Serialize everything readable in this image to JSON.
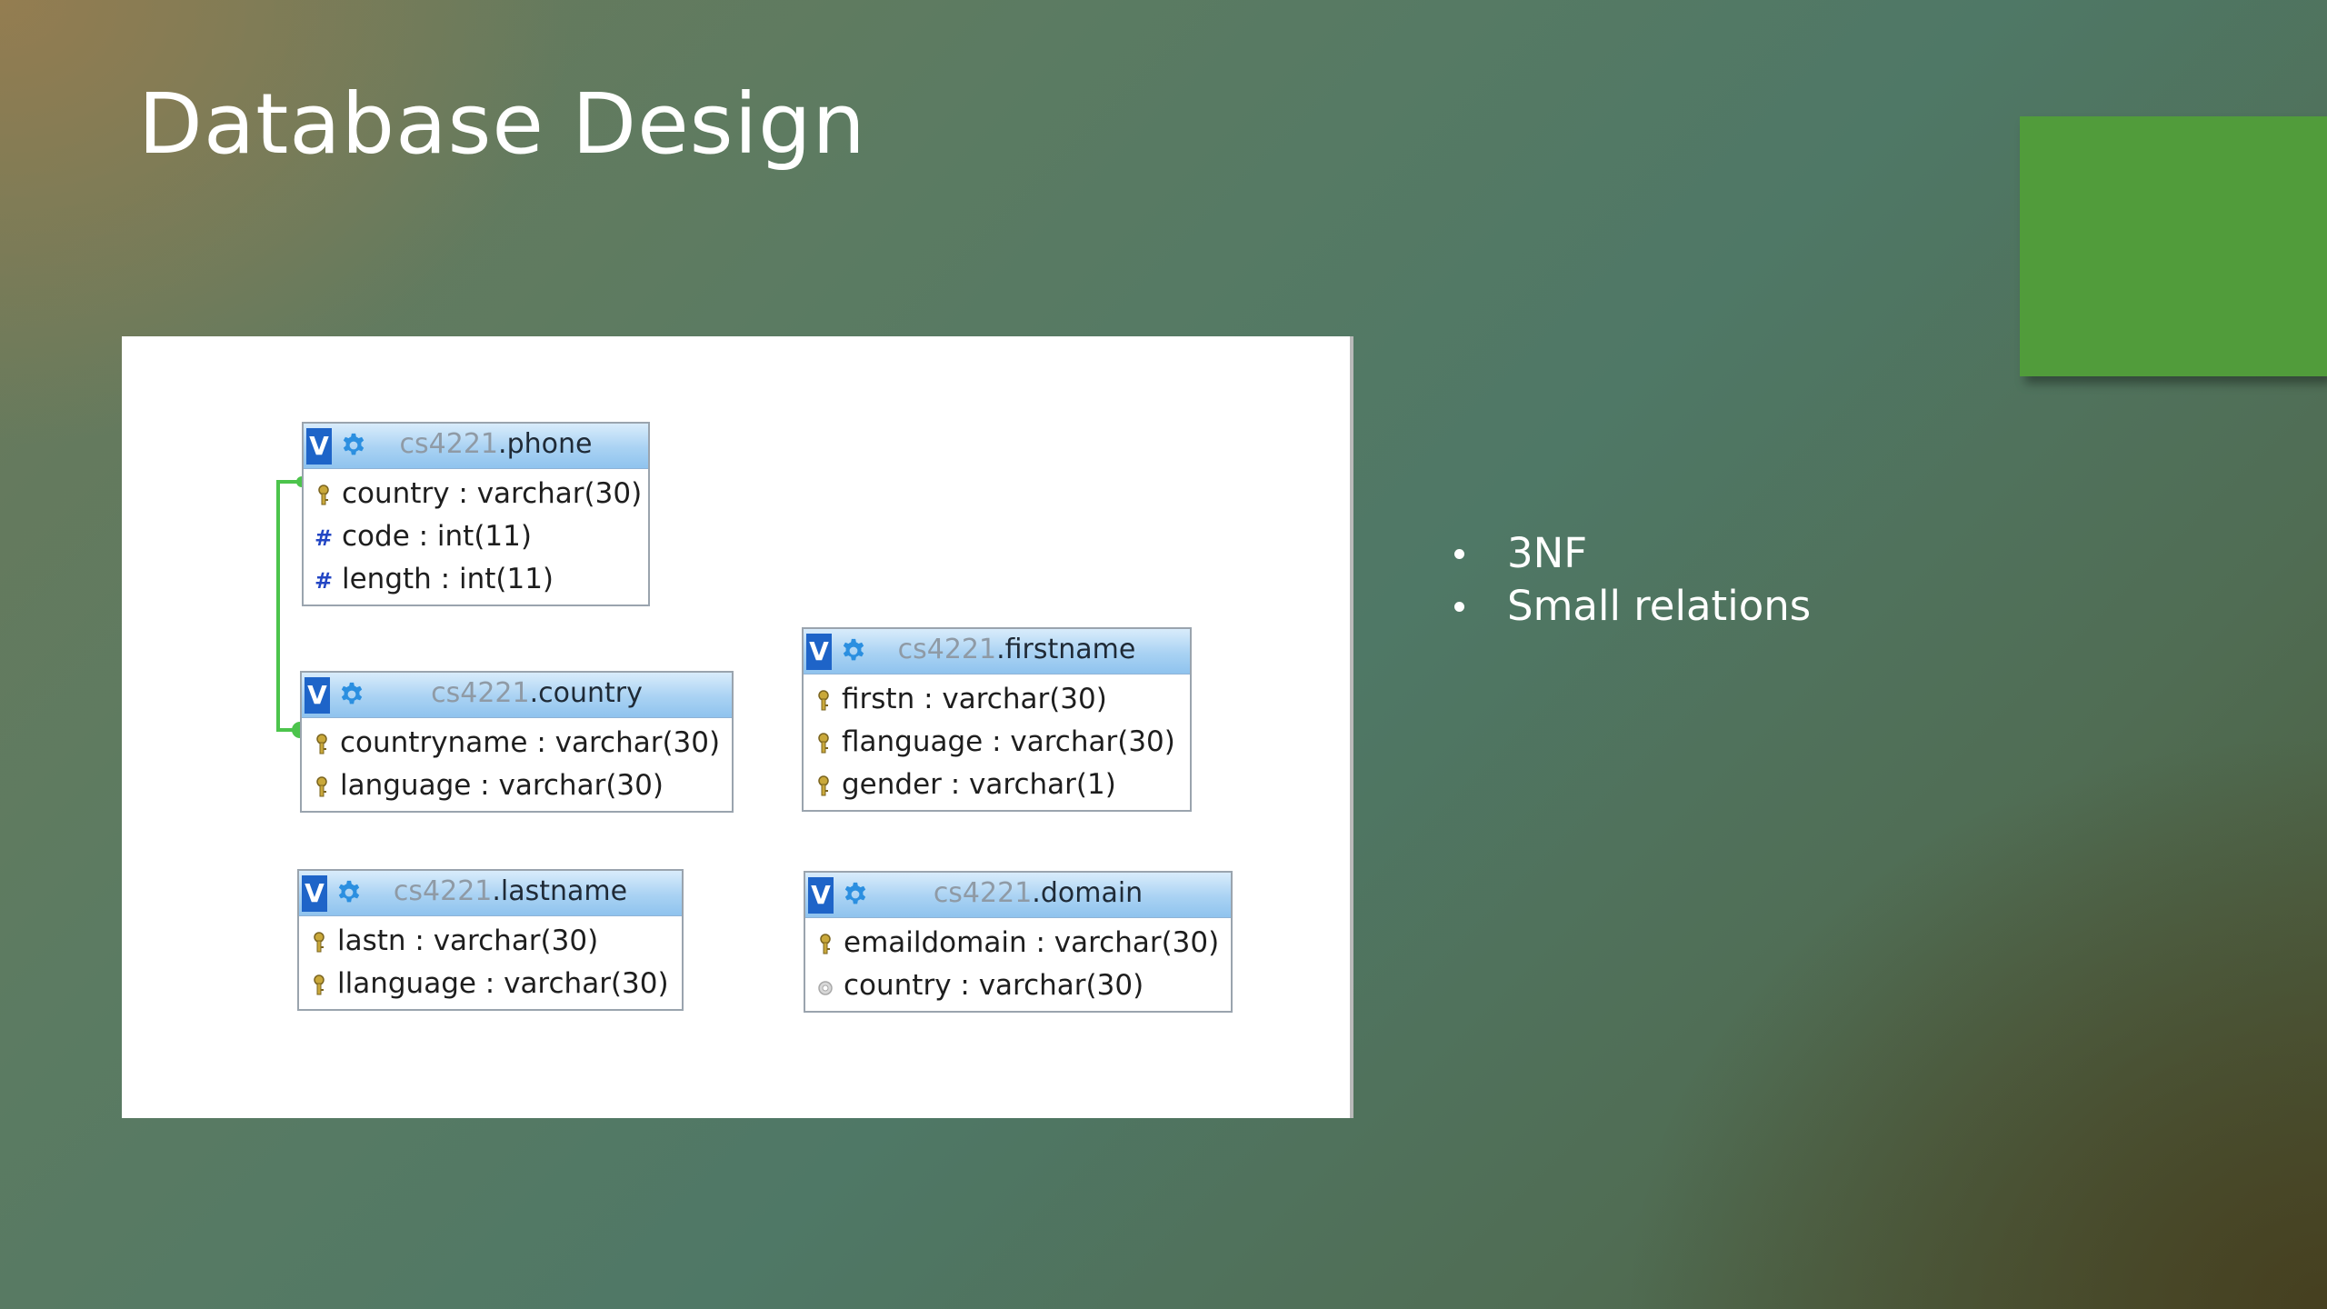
{
  "slide": {
    "title": "Database Design"
  },
  "colors": {
    "accent_square": "#519c3b",
    "relationship_line": "#4cc44c",
    "header_badge": "#1e64c8"
  },
  "diagram": {
    "tables": [
      {
        "schema": "cs4221",
        "name": ".phone",
        "fields": [
          {
            "text": "country : varchar(30)",
            "icon": "key-icon"
          },
          {
            "text": "code : int(11)",
            "icon": "hash-icon"
          },
          {
            "text": "length : int(11)",
            "icon": "hash-icon"
          }
        ]
      },
      {
        "schema": "cs4221",
        "name": ".country",
        "fields": [
          {
            "text": "countryname : varchar(30)",
            "icon": "key-icon"
          },
          {
            "text": "language : varchar(30)",
            "icon": "key-icon"
          }
        ]
      },
      {
        "schema": "cs4221",
        "name": ".firstname",
        "fields": [
          {
            "text": "firstn : varchar(30)",
            "icon": "key-icon"
          },
          {
            "text": "flanguage : varchar(30)",
            "icon": "key-icon"
          },
          {
            "text": "gender : varchar(1)",
            "icon": "key-icon"
          }
        ]
      },
      {
        "schema": "cs4221",
        "name": ".lastname",
        "fields": [
          {
            "text": "lastn : varchar(30)",
            "icon": "key-icon"
          },
          {
            "text": "llanguage : varchar(30)",
            "icon": "key-icon"
          }
        ]
      },
      {
        "schema": "cs4221",
        "name": ".domain",
        "fields": [
          {
            "text": "emaildomain : varchar(30)",
            "icon": "key-icon"
          },
          {
            "text": "country : varchar(30)",
            "icon": "column-icon"
          }
        ]
      }
    ]
  },
  "bullets": [
    "3NF",
    "Small relations"
  ]
}
